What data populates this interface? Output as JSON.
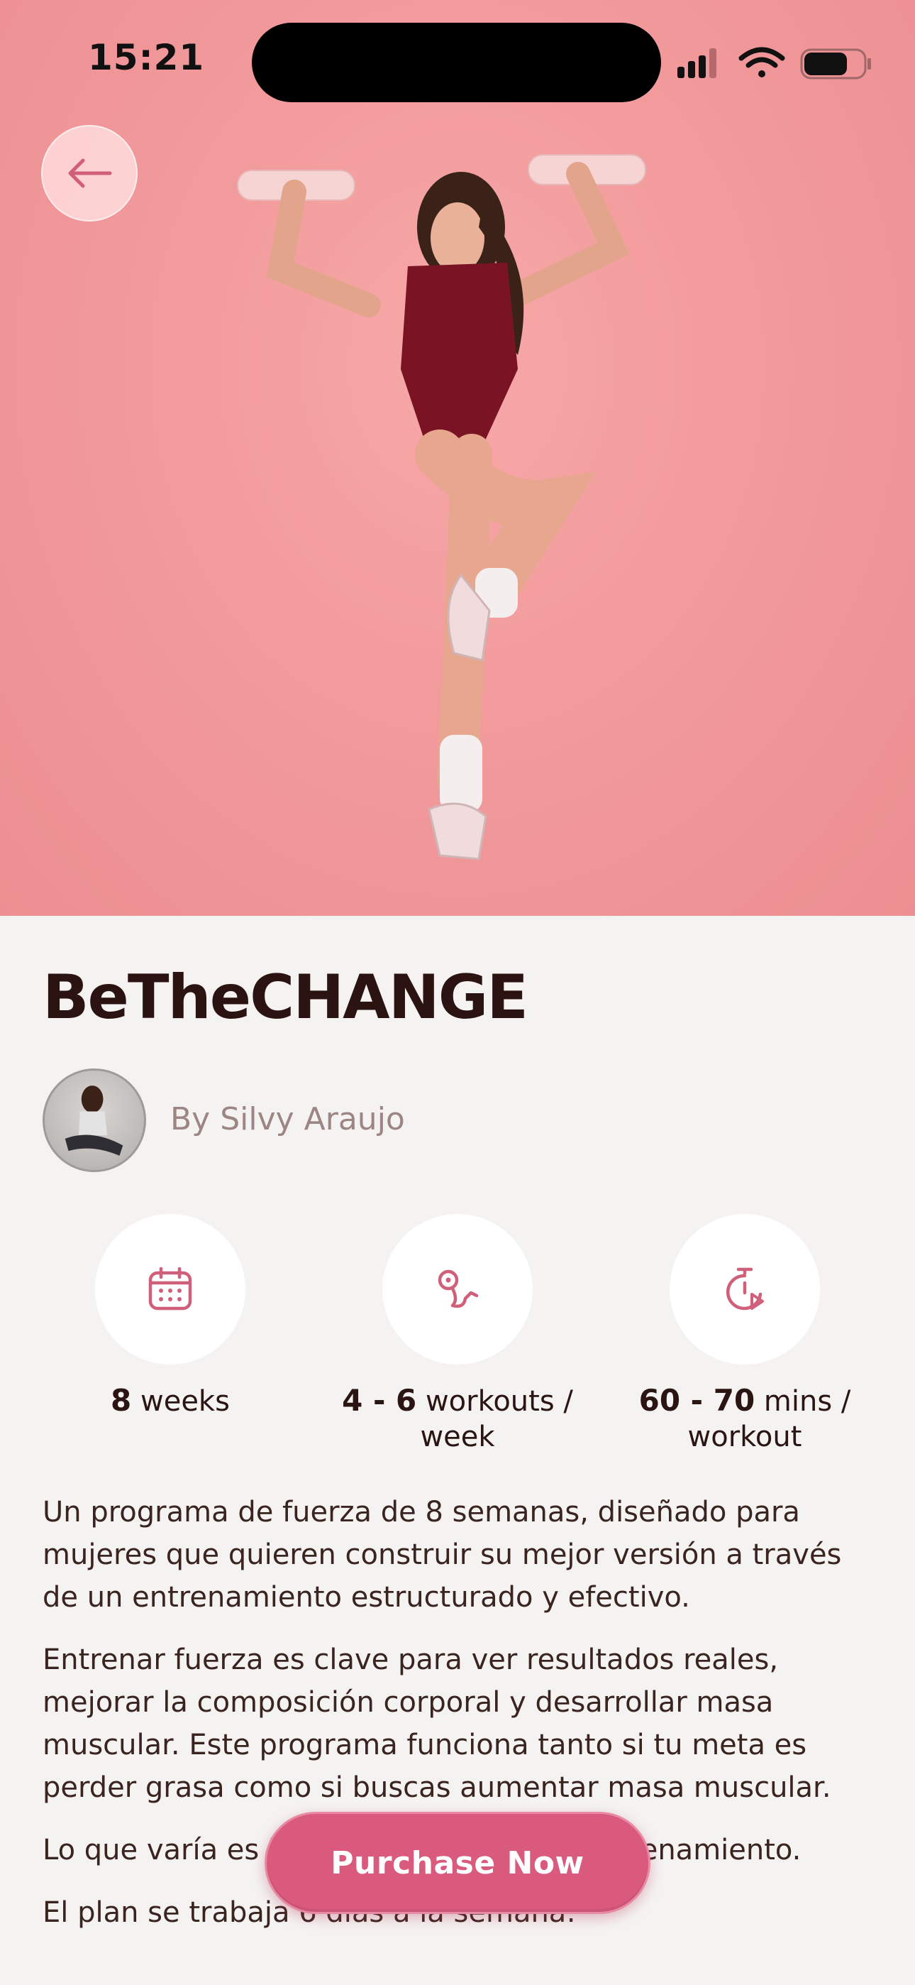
{
  "status_bar": {
    "time": "15:21"
  },
  "program": {
    "title": "BeTheCHANGE",
    "author": "By Silvy Araujo"
  },
  "stats": [
    {
      "icon": "calendar-icon",
      "value": "8",
      "unit": "weeks",
      "line2": ""
    },
    {
      "icon": "workout-route-icon",
      "value": "4 - 6",
      "unit": "workouts /",
      "line2": "week"
    },
    {
      "icon": "timer-icon",
      "value": "60 - 70",
      "unit": "mins /",
      "line2": "workout"
    }
  ],
  "description": [
    "Un programa de fuerza de 8 semanas, diseñado para mujeres que quieren construir su mejor versión a través de un entrenamiento estructurado y efectivo.",
    "Entrenar fuerza es clave para ver resultados reales, mejorar la composición corporal y desarrollar masa muscular. Este programa funciona tanto si tu meta es perder grasa como si buscas aumentar masa muscular.",
    "Lo que varía es la alimentación, no el entrenamiento.",
    "El plan se trabaja 6 días a la semana:"
  ],
  "cta": {
    "label": "Purchase Now"
  },
  "colors": {
    "accent": "#d95a7c",
    "hero_bg": "#f29a9c",
    "icon": "#d0607a",
    "title": "#2a1310"
  }
}
